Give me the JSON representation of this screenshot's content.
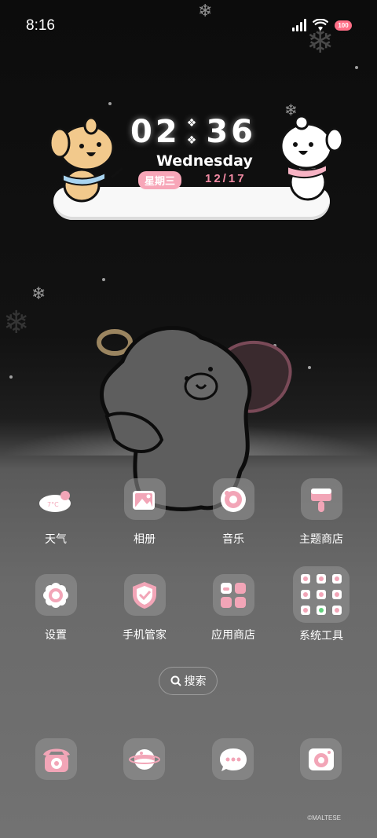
{
  "status_bar": {
    "time": "8:16",
    "battery": "100"
  },
  "clock_widget": {
    "hour": "02",
    "minute": "36",
    "weekday_en": "Wednesday",
    "weekday_cn": "星期三",
    "date": "12/17"
  },
  "apps": [
    {
      "label": "天气",
      "icon": "weather-icon",
      "sub": "7°C"
    },
    {
      "label": "相册",
      "icon": "gallery-icon"
    },
    {
      "label": "音乐",
      "icon": "music-icon"
    },
    {
      "label": "主题商店",
      "icon": "theme-store-icon"
    },
    {
      "label": "设置",
      "icon": "settings-icon"
    },
    {
      "label": "手机管家",
      "icon": "security-icon"
    },
    {
      "label": "应用商店",
      "icon": "app-store-icon"
    },
    {
      "label": "系统工具",
      "icon": "system-tools-folder-icon"
    }
  ],
  "search": {
    "label": "搜索"
  },
  "dock": [
    {
      "icon": "phone-icon"
    },
    {
      "icon": "browser-icon"
    },
    {
      "icon": "messages-icon"
    },
    {
      "icon": "camera-icon"
    }
  ],
  "copyright": "©MALTESE",
  "colors": {
    "accent_pink": "#f28aa3",
    "icon_bg": "#969696"
  }
}
